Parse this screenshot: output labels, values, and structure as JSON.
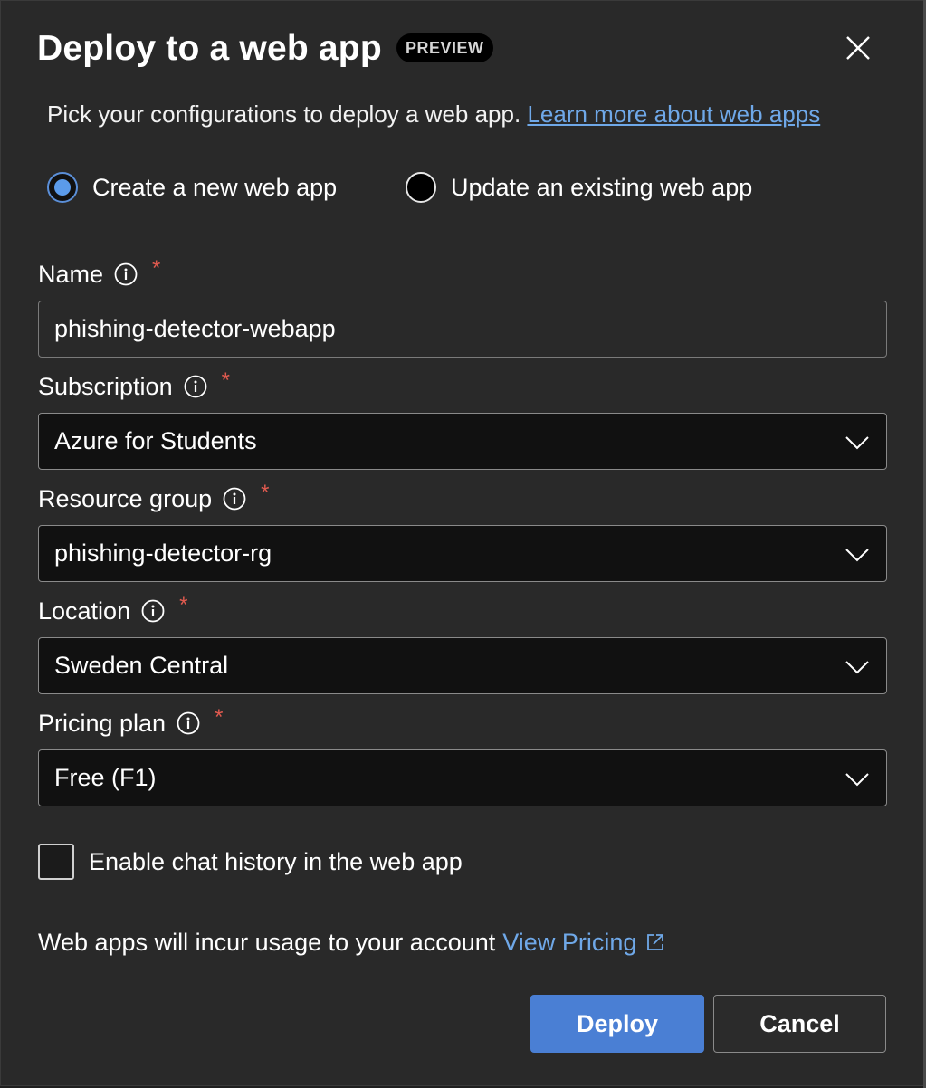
{
  "dialog": {
    "title": "Deploy to a web app",
    "badge": "PREVIEW",
    "subtitle_text": "Pick your configurations to deploy a web app.",
    "subtitle_link": "Learn more about web apps",
    "close_icon": "close-icon"
  },
  "mode": {
    "options": [
      {
        "label": "Create a new web app",
        "checked": true
      },
      {
        "label": "Update an existing web app",
        "checked": false
      }
    ]
  },
  "fields": {
    "name": {
      "label": "Name",
      "required": "*",
      "value": "phishing-detector-webapp"
    },
    "subscription": {
      "label": "Subscription",
      "required": "*",
      "value": "Azure for Students"
    },
    "resource_group": {
      "label": "Resource group",
      "required": "*",
      "value": "phishing-detector-rg"
    },
    "location": {
      "label": "Location",
      "required": "*",
      "value": "Sweden Central"
    },
    "pricing_plan": {
      "label": "Pricing plan",
      "required": "*",
      "value": "Free (F1)"
    }
  },
  "chat_history": {
    "label": "Enable chat history in the web app",
    "checked": false
  },
  "usage": {
    "text": "Web apps will incur usage to your account",
    "link": "View Pricing"
  },
  "buttons": {
    "deploy": "Deploy",
    "cancel": "Cancel"
  },
  "colors": {
    "background": "#292929",
    "accent": "#4a7fd4",
    "link": "#6fa8e8",
    "required": "#e05a4f"
  }
}
